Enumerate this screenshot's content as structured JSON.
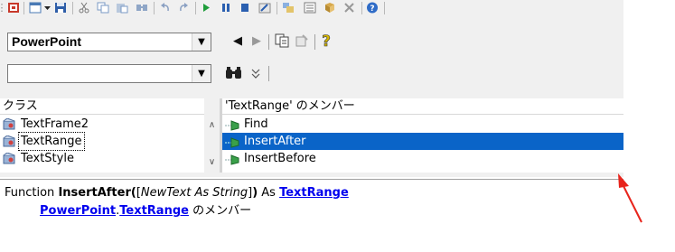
{
  "toolbar": {
    "icons": [
      "view-ms-app-icon",
      "insert-userform-icon",
      "dropdown-arrow-icon",
      "save-icon",
      "cut-icon",
      "copy-icon",
      "paste-icon",
      "find-icon",
      "undo-icon",
      "redo-icon",
      "run-icon",
      "break-icon",
      "reset-icon",
      "design-mode-icon",
      "project-explorer-icon",
      "properties-icon",
      "object-browser-icon",
      "toolbox-icon",
      "help-icon"
    ]
  },
  "browser": {
    "library_combo": {
      "value": "PowerPoint"
    },
    "search_combo": {
      "value": ""
    }
  },
  "classes": {
    "header": "クラス",
    "items": [
      {
        "label": "TextFrame2",
        "selected": false
      },
      {
        "label": "TextRange",
        "selected": true
      },
      {
        "label": "TextStyle",
        "selected": false
      }
    ]
  },
  "members": {
    "header": "'TextRange' のメンバー",
    "items": [
      {
        "label": "Find",
        "selected": false
      },
      {
        "label": "InsertAfter",
        "selected": true
      },
      {
        "label": "InsertBefore",
        "selected": false
      }
    ]
  },
  "details": {
    "prefix": "Function ",
    "name": "InsertAfter(",
    "param_open": "[",
    "param": "NewText As String",
    "param_close": "]",
    "close": ")",
    "as_word": " As ",
    "return_type": "TextRange",
    "library_link": "PowerPoint",
    "dot": ".",
    "class_link": "TextRange",
    "member_of": " のメンバー"
  },
  "colors": {
    "selection": "#0a64c8",
    "link": "#0000ee",
    "annotation_arrow": "#e8241c"
  }
}
